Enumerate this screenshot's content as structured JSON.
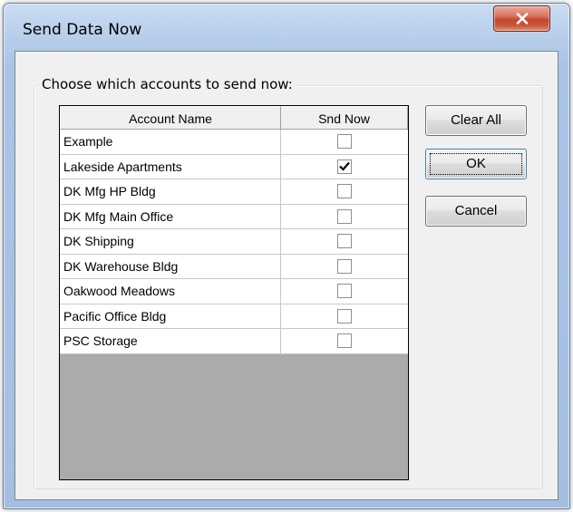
{
  "window": {
    "title": "Send Data Now"
  },
  "group": {
    "label": "Choose which accounts to send now:"
  },
  "grid": {
    "columns": [
      "Account Name",
      "Snd Now"
    ],
    "rows": [
      {
        "name": "Example",
        "send": false
      },
      {
        "name": "Lakeside Apartments",
        "send": true
      },
      {
        "name": "DK Mfg HP Bldg",
        "send": false
      },
      {
        "name": "DK Mfg Main Office",
        "send": false
      },
      {
        "name": "DK Shipping",
        "send": false
      },
      {
        "name": "DK Warehouse Bldg",
        "send": false
      },
      {
        "name": "Oakwood Meadows",
        "send": false
      },
      {
        "name": "Pacific Office Bldg",
        "send": false
      },
      {
        "name": "PSC Storage",
        "send": false
      }
    ]
  },
  "buttons": {
    "clear_all": "Clear All",
    "ok": "OK",
    "cancel": "Cancel"
  },
  "icons": {
    "close": "close-icon",
    "check": "checkmark-icon"
  },
  "colors": {
    "close_button": "#c5452d",
    "frame": "#abc4e6",
    "client": "#f0f0f0",
    "grid_empty": "#ababab"
  }
}
